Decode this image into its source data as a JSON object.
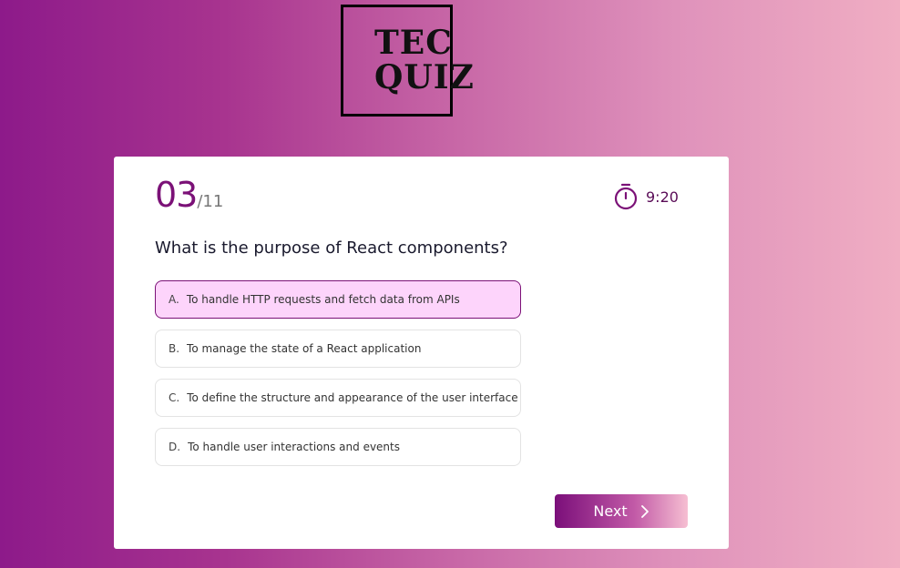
{
  "logo": {
    "line1": "TEC",
    "line2": "QUIZ"
  },
  "quiz": {
    "current": "03",
    "total": "/11",
    "timer": "9:20",
    "question": "What is the purpose of React components?",
    "options": [
      {
        "letter": "A.",
        "text": "To handle HTTP requests and fetch data from APIs",
        "selected": true
      },
      {
        "letter": "B.",
        "text": "To manage the state of a React application",
        "selected": false
      },
      {
        "letter": "C.",
        "text": "To define the structure and appearance of the user interface",
        "selected": false
      },
      {
        "letter": "D.",
        "text": "To handle user interactions and events",
        "selected": false
      }
    ],
    "next_label": "Next"
  },
  "icons": {
    "timer": "stopwatch-icon",
    "next": "chevron-right-icon"
  },
  "colors": {
    "accent": "#7b1177",
    "selected_bg": "#fdd4fb",
    "gradient_start": "#8d1a8a",
    "gradient_end": "#f0aec3"
  }
}
